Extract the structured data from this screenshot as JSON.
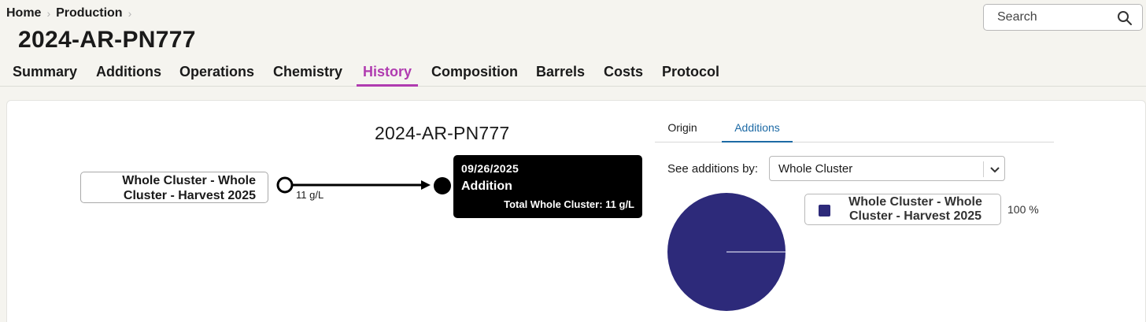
{
  "breadcrumb": {
    "items": [
      "Home",
      "Production"
    ]
  },
  "page_title": "2024-AR-PN777",
  "search": {
    "placeholder": "Search",
    "icon": "search-icon"
  },
  "tabs": [
    "Summary",
    "Additions",
    "Operations",
    "Chemistry",
    "History",
    "Composition",
    "Barrels",
    "Costs",
    "Protocol"
  ],
  "active_tab": "History",
  "accent_color": "#b03cb0",
  "graph": {
    "title": "2024-AR-PN777",
    "source_node": "Whole Cluster - Whole Cluster - Harvest 2025",
    "edge_label": "11 g/L",
    "event": {
      "date": "09/26/2025",
      "type": "Addition",
      "total": "Total Whole Cluster: 11 g/L"
    }
  },
  "right_panel": {
    "subtabs": [
      "Origin",
      "Additions"
    ],
    "active_subtab": "Additions",
    "see_by_label": "See additions by:",
    "see_by_value": "Whole Cluster",
    "legend": {
      "label": "Whole Cluster - Whole Cluster - Harvest 2025",
      "percent": "100 %",
      "color": "#2d2a7a"
    }
  },
  "chart_data": {
    "type": "pie",
    "categories": [
      "Whole Cluster - Whole Cluster - Harvest 2025"
    ],
    "values": [
      100
    ],
    "colors": [
      "#2d2a7a"
    ]
  }
}
